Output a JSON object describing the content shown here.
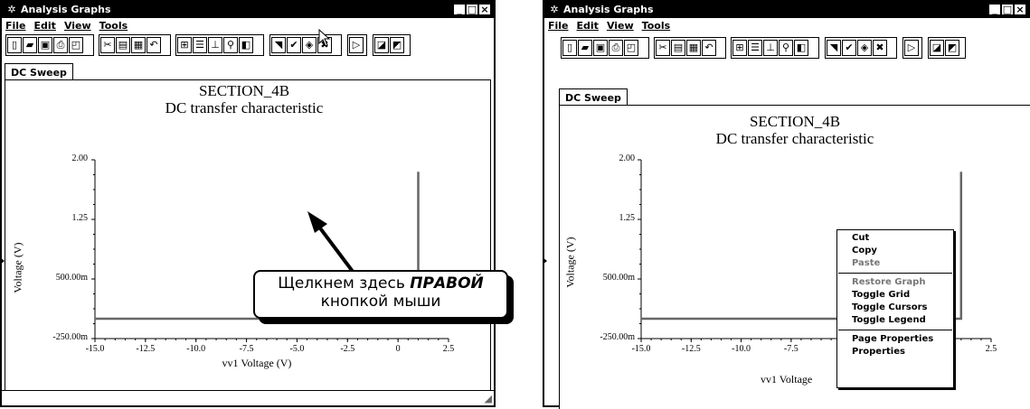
{
  "left_window": {
    "title": "Analysis Graphs",
    "menu": [
      "File",
      "Edit",
      "View",
      "Tools"
    ],
    "tab": "DC Sweep",
    "graph": {
      "title": "SECTION_4B",
      "subtitle": "DC transfer characteristic",
      "ylabel": "Voltage (V)",
      "xlabel": "vv1 Voltage (V)",
      "y_ticks": [
        "2.00",
        "1.25",
        "500.00m",
        "-250.00m"
      ],
      "x_ticks": [
        "-15.0",
        "-12.5",
        "-10.0",
        "-7.5",
        "-5.0",
        "-2.5",
        "0",
        "2.5"
      ]
    },
    "callout": {
      "line1_prefix": "Щелкнем здесь ",
      "line1_emph": "ПРАВОЙ",
      "line2": "кнопкой мыши"
    }
  },
  "right_window": {
    "title": "Analysis Graphs",
    "menu": [
      "File",
      "Edit",
      "View",
      "Tools"
    ],
    "tab": "DC Sweep",
    "graph": {
      "title": "SECTION_4B",
      "subtitle": "DC transfer characteristic",
      "ylabel": "Voltage (V)",
      "xlabel": "vv1 Voltage",
      "y_ticks": [
        "2.00",
        "1.25",
        "500.00m",
        "-250.00m"
      ],
      "x_ticks": [
        "-15.0",
        "-12.5",
        "-10.0",
        "-7.5",
        "2.5"
      ]
    },
    "context_menu": {
      "items": [
        {
          "label": "Cut",
          "enabled": true
        },
        {
          "label": "Copy",
          "enabled": true
        },
        {
          "label": "Paste",
          "enabled": false
        },
        {
          "separator": true
        },
        {
          "label": "Restore Graph",
          "enabled": false
        },
        {
          "label": "Toggle Grid",
          "enabled": true
        },
        {
          "label": "Toggle Cursors",
          "enabled": true
        },
        {
          "label": "Toggle Legend",
          "enabled": true
        },
        {
          "separator": true
        },
        {
          "label": "Page Properties",
          "enabled": true
        },
        {
          "label": "Properties",
          "enabled": true
        }
      ]
    }
  },
  "chart_data": [
    {
      "type": "line",
      "title": "SECTION_4B",
      "subtitle": "DC transfer characteristic",
      "xlabel": "vv1 Voltage (V)",
      "ylabel": "Voltage (V)",
      "xlim": [
        -15.0,
        2.5
      ],
      "ylim": [
        -0.25,
        2.0
      ],
      "x_ticks": [
        -15.0,
        -12.5,
        -10.0,
        -7.5,
        -5.0,
        -2.5,
        0,
        2.5
      ],
      "y_ticks": [
        2.0,
        1.25,
        0.5,
        -0.25
      ],
      "series": [
        {
          "x": [
            -15.0,
            1.0,
            1.0
          ],
          "y": [
            0.0,
            0.0,
            1.85
          ]
        }
      ]
    }
  ],
  "colors": {
    "curve": "#666666",
    "titlebar": "#000000"
  }
}
